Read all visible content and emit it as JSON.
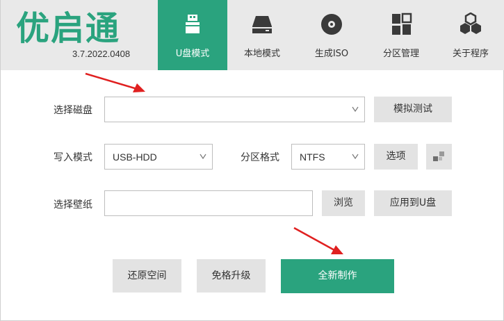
{
  "app": {
    "logo_text": "优启通",
    "version": "3.7.2022.0408"
  },
  "nav": {
    "tabs": [
      {
        "label": "U盘模式",
        "icon": "usb-drive-icon",
        "active": true
      },
      {
        "label": "本地模式",
        "icon": "hard-disk-icon",
        "active": false
      },
      {
        "label": "生成ISO",
        "icon": "disc-icon",
        "active": false
      },
      {
        "label": "分区管理",
        "icon": "partition-grid-icon",
        "active": false
      },
      {
        "label": "关于程序",
        "icon": "hexagon-cluster-icon",
        "active": false
      }
    ]
  },
  "form": {
    "disk": {
      "label": "选择磁盘",
      "value": "",
      "simulate_button": "模拟测试"
    },
    "write_mode": {
      "label": "写入模式",
      "value": "USB-HDD"
    },
    "partition_format": {
      "label": "分区格式",
      "value": "NTFS",
      "options_button": "选项"
    },
    "wallpaper": {
      "label": "选择壁纸",
      "value": "",
      "browse_button": "浏览",
      "apply_button": "应用到U盘"
    }
  },
  "actions": {
    "restore_space": "还原空间",
    "upgrade_no_format": "免格升级",
    "create_new": "全新制作"
  },
  "colors": {
    "accent": "#2aa37e",
    "header_bg": "#e9e9e9",
    "button_bg": "#e3e3e3",
    "annotation_arrow": "#e02020"
  }
}
